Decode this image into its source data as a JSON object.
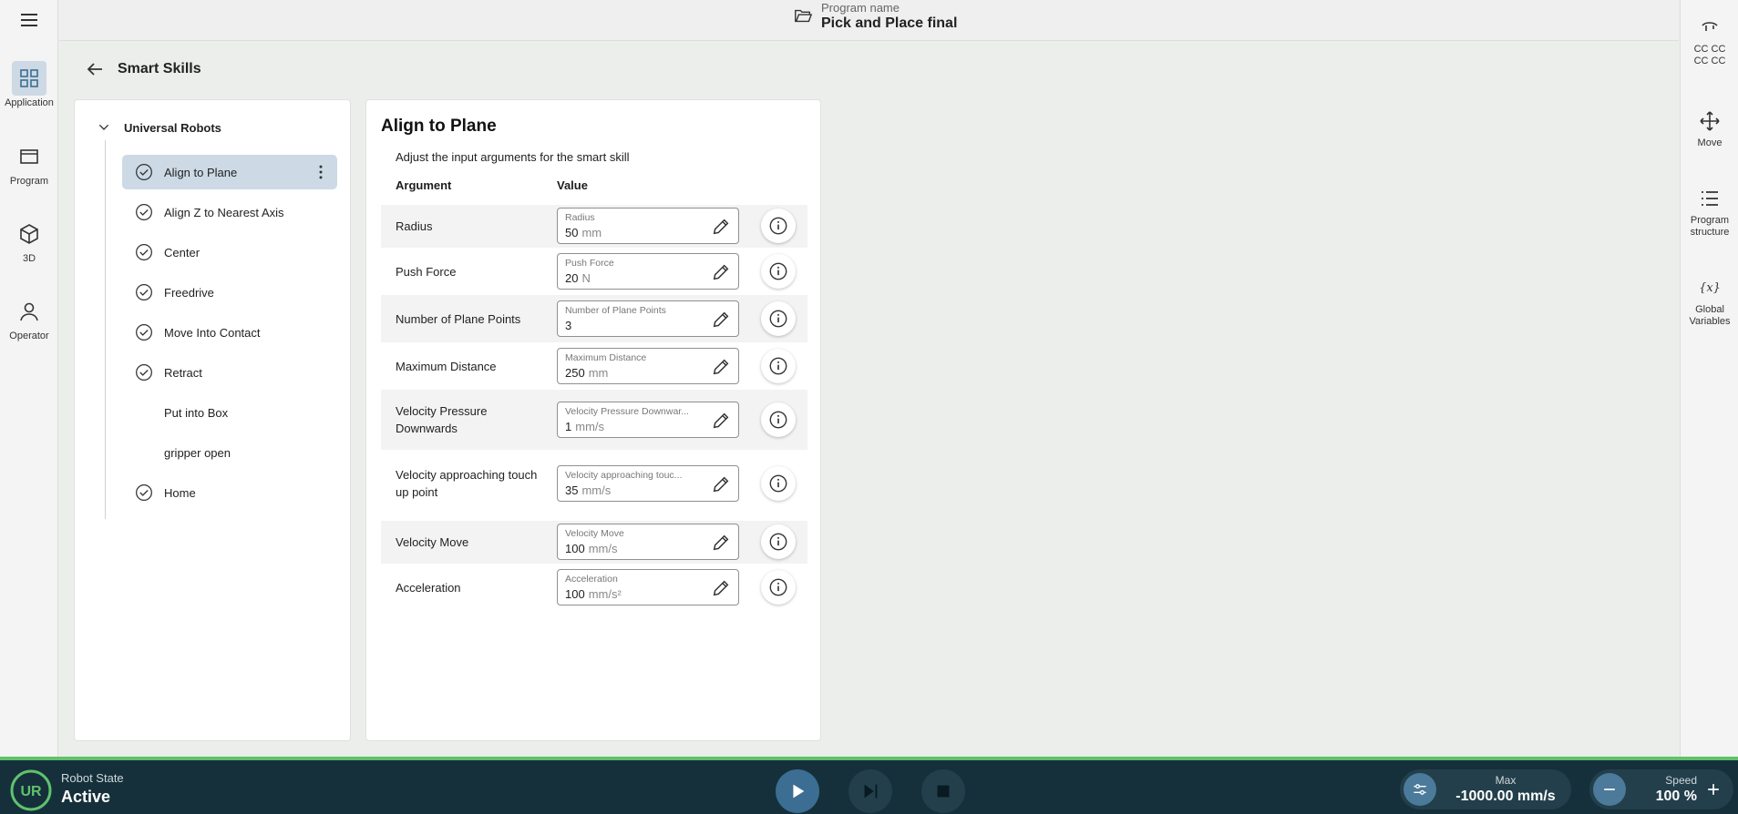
{
  "left_rail": {
    "items": [
      {
        "label": "Application",
        "icon": "grid-icon",
        "active": true
      },
      {
        "label": "Program",
        "icon": "program-icon"
      },
      {
        "label": "3D",
        "icon": "cube-icon"
      },
      {
        "label": "Operator",
        "icon": "person-icon"
      }
    ]
  },
  "right_rail": {
    "top_label_1": "CC CC",
    "top_label_2": "CC CC",
    "items": [
      {
        "label": "Move",
        "icon": "move-arrows-icon"
      },
      {
        "label_1": "Program",
        "label_2": "structure",
        "icon": "list-icon"
      },
      {
        "label_1": "Global",
        "label_2": "Variables",
        "icon": "variable-icon"
      }
    ]
  },
  "header": {
    "program_label": "Program name",
    "program_name": "Pick and Place final"
  },
  "page": {
    "title": "Smart Skills"
  },
  "tree": {
    "group": "Universal Robots",
    "items": [
      {
        "label": "Align to Plane",
        "checked": true,
        "selected": true
      },
      {
        "label": "Align Z to Nearest Axis",
        "checked": true
      },
      {
        "label": "Center",
        "checked": true
      },
      {
        "label": "Freedrive",
        "checked": true
      },
      {
        "label": "Move Into Contact",
        "checked": true
      },
      {
        "label": "Retract",
        "checked": true
      },
      {
        "label": "Put into Box",
        "checked": false
      },
      {
        "label": "gripper open",
        "checked": false
      },
      {
        "label": "Home",
        "checked": true
      }
    ]
  },
  "args": {
    "title": "Align to Plane",
    "description": "Adjust the input arguments for the smart skill",
    "col_argument": "Argument",
    "col_value": "Value",
    "rows": [
      {
        "label": "Radius",
        "field_label": "Radius",
        "value": "50",
        "unit": "mm"
      },
      {
        "label": "Push Force",
        "field_label": "Push Force",
        "value": "20",
        "unit": "N"
      },
      {
        "label": "Number of Plane Points",
        "field_label": "Number of Plane Points",
        "value": "3",
        "unit": ""
      },
      {
        "label": "Maximum Distance",
        "field_label": "Maximum Distance",
        "value": "250",
        "unit": "mm"
      },
      {
        "label": "Velocity Pressure Downwards",
        "field_label": "Velocity Pressure Downwar...",
        "value": "1",
        "unit": "mm/s"
      },
      {
        "label": "Velocity approaching touch up point",
        "field_label": "Velocity approaching touc...",
        "value": "35",
        "unit": "mm/s"
      },
      {
        "label": "Velocity Move",
        "field_label": "Velocity Move",
        "value": "100",
        "unit": "mm/s"
      },
      {
        "label": "Acceleration",
        "field_label": "Acceleration",
        "value": "100",
        "unit": "mm/s²"
      }
    ]
  },
  "bottom": {
    "state_label": "Robot State",
    "state_value": "Active",
    "max_label": "Max",
    "max_value": "-1000.00 mm/s",
    "speed_label": "Speed",
    "speed_value": "100 %"
  },
  "colors": {
    "accent": "#3b6e92",
    "bottom_bar": "#15303b",
    "status_line": "#5fc26b",
    "selected": "#cddae6"
  }
}
